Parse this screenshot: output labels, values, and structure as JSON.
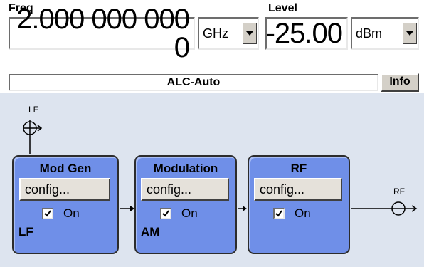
{
  "frequency": {
    "label": "Freq",
    "value": "2.000 000 000 0",
    "unit": "GHz"
  },
  "level": {
    "label": "Level",
    "value": "-25.00",
    "unit": "dBm"
  },
  "status": {
    "text": "ALC-Auto",
    "info_button": "Info"
  },
  "diagram": {
    "lf_input_label": "LF",
    "rf_output_label": "RF",
    "blocks": [
      {
        "title": "Mod Gen",
        "config_label": "config...",
        "checkbox_label": "On",
        "checked": true,
        "sub_label": "LF"
      },
      {
        "title": "Modulation",
        "config_label": "config...",
        "checkbox_label": "On",
        "checked": true,
        "sub_label": "AM"
      },
      {
        "title": "RF",
        "config_label": "config...",
        "checkbox_label": "On",
        "checked": true,
        "sub_label": ""
      }
    ]
  },
  "colors": {
    "block_fill": "#6f8fe8",
    "diagram_background": "#dde4ef",
    "button_face": "#d4d0c8"
  }
}
